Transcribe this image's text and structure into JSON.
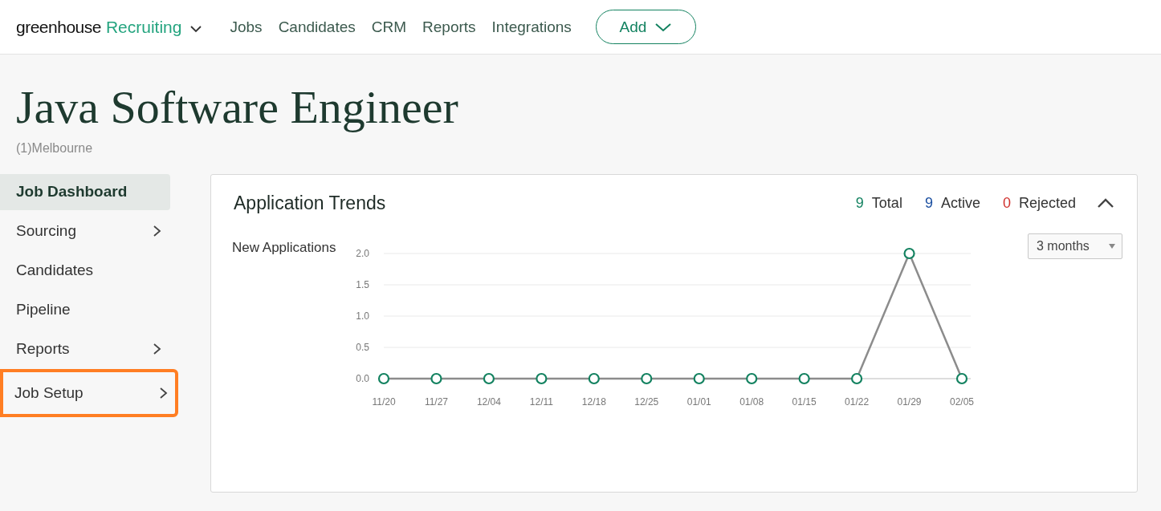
{
  "header": {
    "brand": "greenhouse",
    "product": "Recruiting",
    "nav": [
      "Jobs",
      "Candidates",
      "CRM",
      "Reports",
      "Integrations"
    ],
    "add_button": "Add"
  },
  "job": {
    "title": "Java Software Engineer",
    "location": "(1)Melbourne"
  },
  "sidebar": {
    "items": [
      {
        "label": "Job Dashboard",
        "selected": true,
        "expandable": false,
        "highlighted": false
      },
      {
        "label": "Sourcing",
        "selected": false,
        "expandable": true,
        "highlighted": false
      },
      {
        "label": "Candidates",
        "selected": false,
        "expandable": false,
        "highlighted": false
      },
      {
        "label": "Pipeline",
        "selected": false,
        "expandable": false,
        "highlighted": false
      },
      {
        "label": "Reports",
        "selected": false,
        "expandable": true,
        "highlighted": false
      },
      {
        "label": "Job Setup",
        "selected": false,
        "expandable": true,
        "highlighted": true
      }
    ]
  },
  "panel": {
    "title": "Application Trends",
    "expanded": true,
    "stats": [
      {
        "count": "9",
        "label": "Total",
        "color": "#138260"
      },
      {
        "count": "9",
        "label": "Active",
        "color": "#1a4ea0"
      },
      {
        "count": "0",
        "label": "Rejected",
        "color": "#d0312d"
      }
    ],
    "range": "3 months",
    "chart_data": {
      "type": "line",
      "grid": true,
      "categories": [
        "11/20",
        "11/27",
        "12/04",
        "12/11",
        "12/18",
        "12/25",
        "01/01",
        "01/08",
        "01/15",
        "01/22",
        "01/29",
        "02/05"
      ],
      "series": [
        {
          "name": "New Applications",
          "color": "#8c8c8c",
          "marker": "circle",
          "values": [
            0,
            0,
            0,
            0,
            0,
            0,
            0,
            0,
            0,
            0,
            2,
            0
          ]
        }
      ],
      "ylim": [
        0,
        2
      ],
      "yticks": [
        {
          "value": 0,
          "label": "0.0"
        },
        {
          "value": 0.5,
          "label": "0.5"
        },
        {
          "value": 1,
          "label": "1.0"
        },
        {
          "value": 1.5,
          "label": "1.5"
        },
        {
          "value": 2,
          "label": "2.0"
        }
      ]
    }
  }
}
